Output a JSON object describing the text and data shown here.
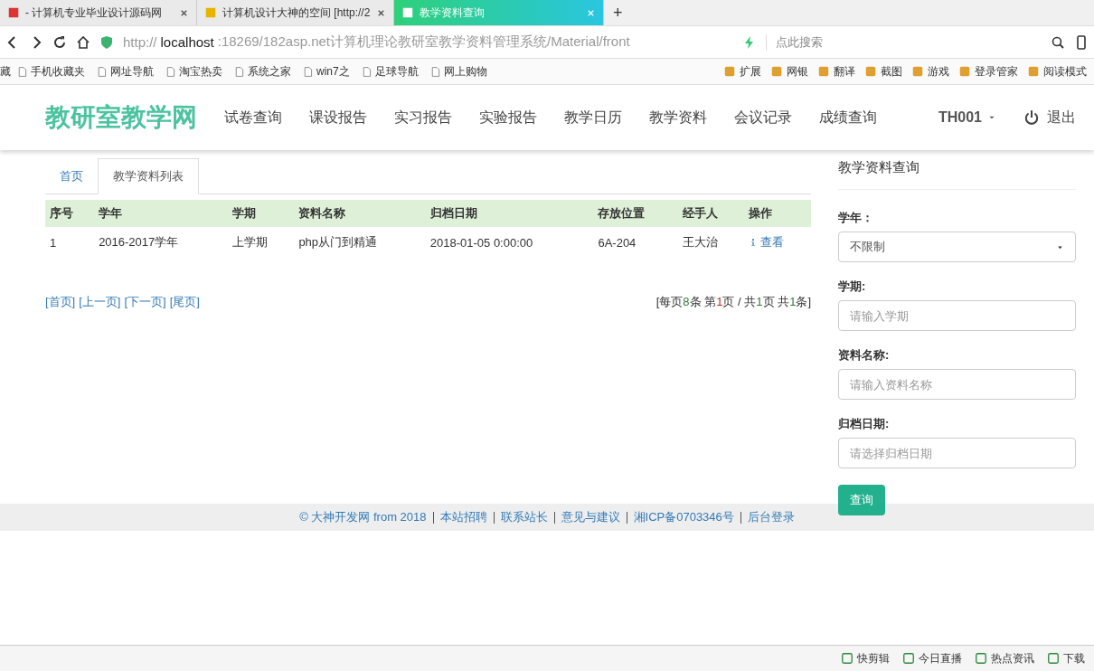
{
  "browser": {
    "tabs": [
      {
        "title": "- 计算机专业毕业设计源码网",
        "selected": false
      },
      {
        "title": "计算机设计大神的空间 [http://2",
        "selected": false
      },
      {
        "title": "教学资料查询",
        "selected": true
      }
    ],
    "new_tab": "+",
    "address": {
      "scheme": "http://",
      "host": "localhost",
      "path": ":18269/182asp.net计算机理论教研室教学资料管理系统/Material/front"
    },
    "search_placeholder": "点此搜索",
    "bookmarks": [
      "藏",
      "手机收藏夹",
      "网址导航",
      "淘宝热卖",
      "系统之家",
      "win7之",
      "足球导航",
      "网上购物"
    ],
    "tools": [
      "扩展",
      "网银",
      "翻译",
      "截图",
      "游戏",
      "登录管家",
      "阅读模式"
    ],
    "status_items": [
      "快剪辑",
      "今日直播",
      "热点资讯",
      "下载"
    ]
  },
  "header": {
    "logo": "教研室教学网",
    "nav": [
      "试卷查询",
      "课设报告",
      "实习报告",
      "实验报告",
      "教学日历",
      "教学资料",
      "会议记录",
      "成绩查询"
    ],
    "user": "TH001",
    "logout": "退出"
  },
  "tabs": [
    {
      "label": "首页",
      "selected": false
    },
    {
      "label": "教学资料列表",
      "selected": true
    }
  ],
  "table": {
    "columns": [
      "序号",
      "学年",
      "学期",
      "资料名称",
      "归档日期",
      "存放位置",
      "经手人",
      "操作"
    ],
    "rows": [
      {
        "cells": [
          "1",
          "2016-2017学年",
          "上学期",
          "php从门到精通",
          "2018-01-05 0:00:00",
          "6A-204",
          "王大治"
        ],
        "action": "查看"
      }
    ]
  },
  "pager": {
    "links": [
      "[首页]",
      "[上一页]",
      "[下一页]",
      "[尾页]"
    ],
    "info": [
      {
        "text": "[每页"
      },
      {
        "text": "8",
        "color": "#2e7d32"
      },
      {
        "text": "条 第"
      },
      {
        "text": "1",
        "color": "#c62828"
      },
      {
        "text": "页 / 共"
      },
      {
        "text": "1",
        "color": "#2e7d32"
      },
      {
        "text": "页 共"
      },
      {
        "text": "1",
        "color": "#2e7d32"
      },
      {
        "text": "条]"
      }
    ]
  },
  "search_panel": {
    "title": "教学资料查询",
    "fields": [
      {
        "kind": "select",
        "label": "学年：",
        "value": "不限制"
      },
      {
        "kind": "input",
        "label": "学期:",
        "placeholder": "请输入学期"
      },
      {
        "kind": "input",
        "label": "资料名称:",
        "placeholder": "请输入资料名称"
      },
      {
        "kind": "input",
        "label": "归档日期:",
        "placeholder": "请选择归档日期"
      }
    ],
    "button": "查询"
  },
  "footer": {
    "copyright": "© 大神开发网 from 2018",
    "links": [
      "本站招聘",
      "联系站长",
      "意见与建议",
      "湘ICP备0703346号",
      "后台登录"
    ]
  }
}
